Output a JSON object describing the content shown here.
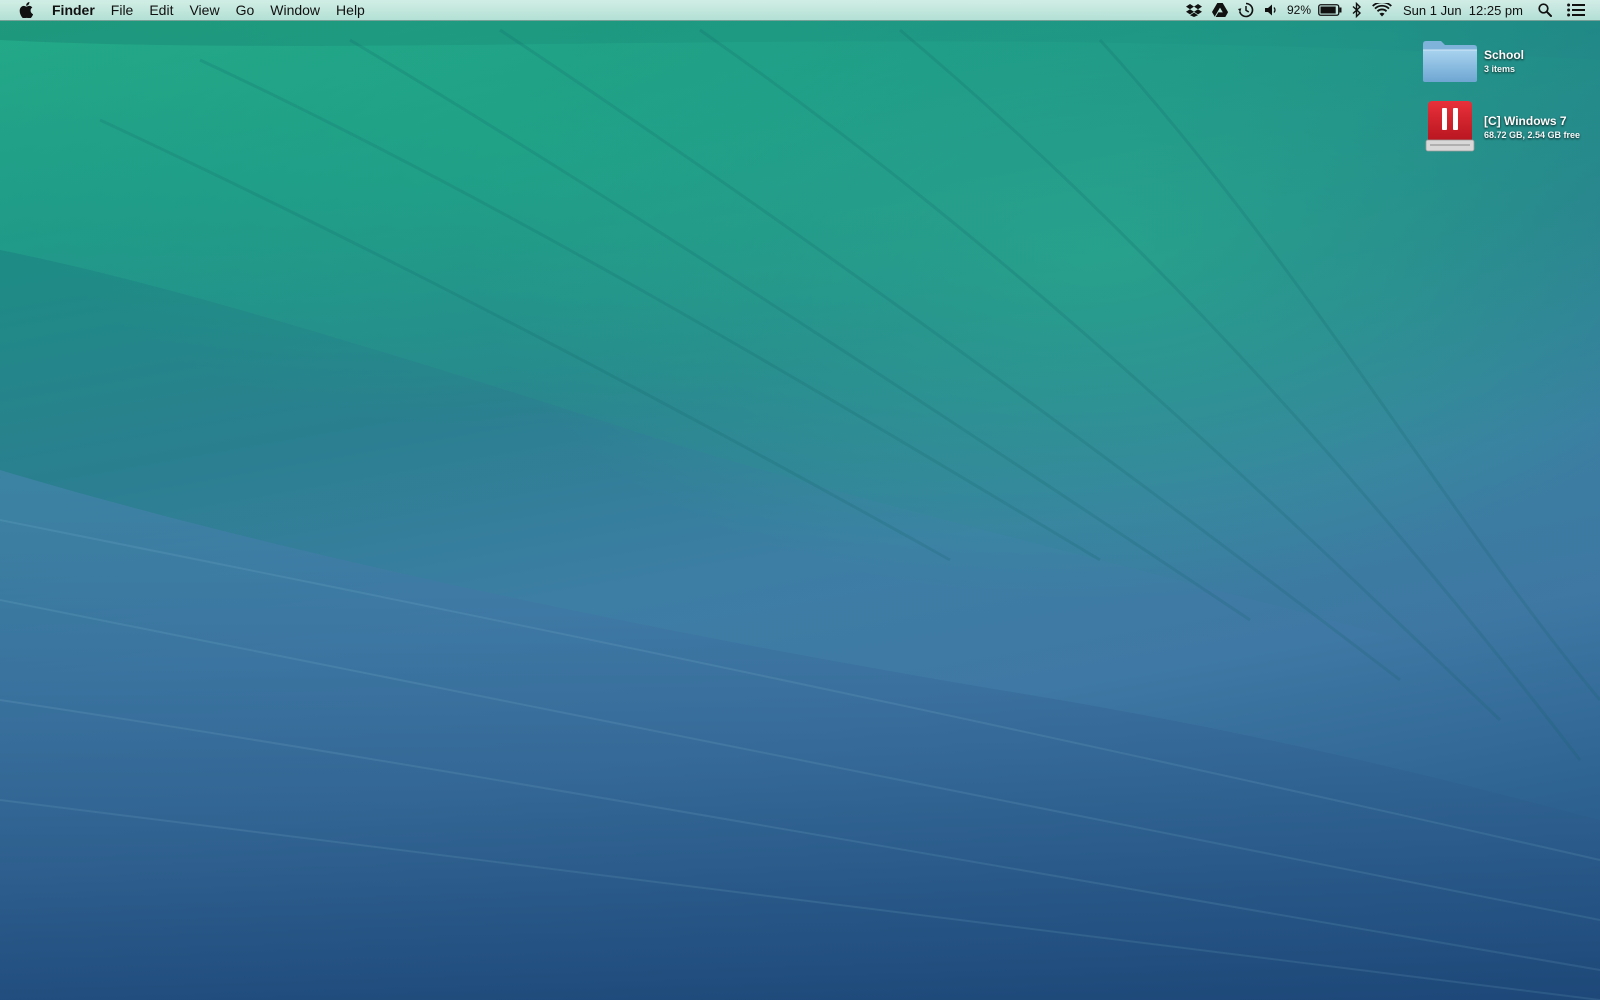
{
  "menubar": {
    "app_name": "Finder",
    "menus": [
      "File",
      "Edit",
      "View",
      "Go",
      "Window",
      "Help"
    ],
    "status": {
      "battery_percent": "92%",
      "battery_level": 0.92,
      "datetime": "Sun 1 Jun  12:25 pm"
    },
    "status_icons": [
      "dropbox-icon",
      "google-drive-icon",
      "time-machine-icon",
      "volume-icon",
      "battery-icon",
      "bluetooth-icon",
      "wifi-icon",
      "spotlight-icon",
      "notification-center-icon"
    ]
  },
  "desktop": {
    "icons": [
      {
        "name": "School",
        "info": "3 items",
        "icon": "folder-icon"
      },
      {
        "name": "[C] Windows 7",
        "info": "68.72 GB, 2.54 GB free",
        "icon": "drive-icon"
      }
    ]
  },
  "colors": {
    "menubar_bg": "#d7f0e8",
    "wave_green": "#1f9a7c",
    "wave_blue": "#3f78a4",
    "deep_blue": "#1f4e7d",
    "drive_red": "#d9232e",
    "folder_blue": "#8fc0e0"
  }
}
